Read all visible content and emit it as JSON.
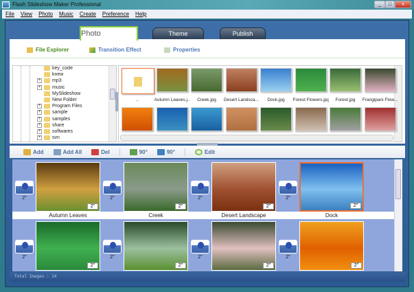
{
  "window": {
    "title": "Flash Slideshow Maker Professional",
    "controls": [
      "_",
      "□",
      "x"
    ]
  },
  "menu": [
    "File",
    "View",
    "Photo",
    "Music",
    "Create",
    "Preference",
    "Help"
  ],
  "main_tabs": [
    {
      "label": "Photo",
      "active": true
    },
    {
      "label": "Theme"
    },
    {
      "label": "Publish"
    }
  ],
  "sub_tabs": [
    {
      "label": "File Explorer",
      "active": true,
      "icon": "folder-icon"
    },
    {
      "label": "Transition Effect",
      "icon": "transition-icon"
    },
    {
      "label": "Properties",
      "icon": "properties-icon"
    }
  ],
  "tree": [
    {
      "label": "key_code",
      "expand": false
    },
    {
      "label": "knew",
      "expand": false
    },
    {
      "label": "mp3",
      "expand": true
    },
    {
      "label": "music",
      "expand": true
    },
    {
      "label": "MySlideshow",
      "expand": false
    },
    {
      "label": "New Folder",
      "expand": false
    },
    {
      "label": "Program Files",
      "expand": true
    },
    {
      "label": "sample",
      "expand": true
    },
    {
      "label": "samples",
      "expand": true
    },
    {
      "label": "share",
      "expand": true
    },
    {
      "label": "softwares",
      "expand": true
    },
    {
      "label": "svn",
      "expand": true
    }
  ],
  "thumbnails": {
    "row1": [
      {
        "label": "..",
        "folder": true,
        "colors": [
          "#fff",
          "#fff"
        ]
      },
      {
        "label": "Autumn Leaves.j...",
        "colors": [
          "#a06a20",
          "#7a9040"
        ]
      },
      {
        "label": "Creek.jpg",
        "colors": [
          "#7a9a6a",
          "#486a30"
        ]
      },
      {
        "label": "Desert Landsca...",
        "colors": [
          "#c08060",
          "#8a4020"
        ]
      },
      {
        "label": "Dock.jpg",
        "colors": [
          "#3a80d0",
          "#9ad0f0"
        ]
      },
      {
        "label": "Forest Flowers.jpg",
        "colors": [
          "#2a8a3a",
          "#50b050"
        ]
      },
      {
        "label": "Forest.jpg",
        "colors": [
          "#3a6a3a",
          "#9ac070"
        ]
      },
      {
        "label": "Frangipani Flow...",
        "colors": [
          "#3a4a30",
          "#e0b0c0"
        ]
      }
    ],
    "row2": [
      {
        "colors": [
          "#f08010",
          "#d05000"
        ]
      },
      {
        "colors": [
          "#1a60b0",
          "#3a90c0"
        ]
      },
      {
        "colors": [
          "#3a9ad0",
          "#1a60a0"
        ]
      },
      {
        "colors": [
          "#d09060",
          "#b07040"
        ]
      },
      {
        "colors": [
          "#2a5a2a",
          "#6a8a4a"
        ]
      },
      {
        "colors": [
          "#8a6a50",
          "#d0c0b0"
        ]
      },
      {
        "colors": [
          "#4a7a3a",
          "#a0a0a0"
        ]
      },
      {
        "colors": [
          "#a03030",
          "#e0a0a0"
        ]
      }
    ]
  },
  "toolbar": [
    {
      "label": "Add",
      "icon": "add-icon"
    },
    {
      "label": "Add All",
      "icon": "add-all-icon"
    },
    {
      "label": "Del",
      "icon": "delete-icon"
    },
    {
      "label": "90°",
      "icon": "rotate-left-icon"
    },
    {
      "label": "90°",
      "icon": "rotate-right-icon"
    },
    {
      "label": "Edit",
      "icon": "edit-icon"
    }
  ],
  "storyboard": {
    "transition_duration": "2\"",
    "slides": [
      {
        "label": "Autumn Leaves",
        "duration": "2\"",
        "colors": [
          "#5a3a10",
          "#d0a040",
          "#6a9030"
        ]
      },
      {
        "label": "Creek",
        "duration": "2\"",
        "colors": [
          "#6a8a5a",
          "#8a9a8a",
          "#3a6a2a"
        ]
      },
      {
        "label": "Desert Landscape",
        "duration": "2\"",
        "colors": [
          "#d0a080",
          "#a05030",
          "#7a3010"
        ]
      },
      {
        "label": "Dock",
        "duration": "2\"",
        "selected": true,
        "colors": [
          "#1a60c0",
          "#80c0f0",
          "#3a80c0"
        ]
      },
      {
        "label": "",
        "duration": "2\"",
        "colors": [
          "#1a6a2a",
          "#40b050",
          "#2a8a3a"
        ]
      },
      {
        "label": "",
        "duration": "2\"",
        "colors": [
          "#2a4a2a",
          "#9ac0a0",
          "#5a9030"
        ]
      },
      {
        "label": "",
        "duration": "2\"",
        "colors": [
          "#3a4a30",
          "#e0c0c0",
          "#5a6a40"
        ]
      },
      {
        "label": "",
        "duration": "2\"",
        "colors": [
          "#f0a020",
          "#e06000",
          "#f09010"
        ]
      }
    ]
  },
  "status": "Total Images : 14",
  "colors": {
    "accent_green": "#8ccf3c",
    "frame_blue": "#2c5a92",
    "storyboard_bg": "#8fa6dd",
    "selection": "#f07030"
  }
}
